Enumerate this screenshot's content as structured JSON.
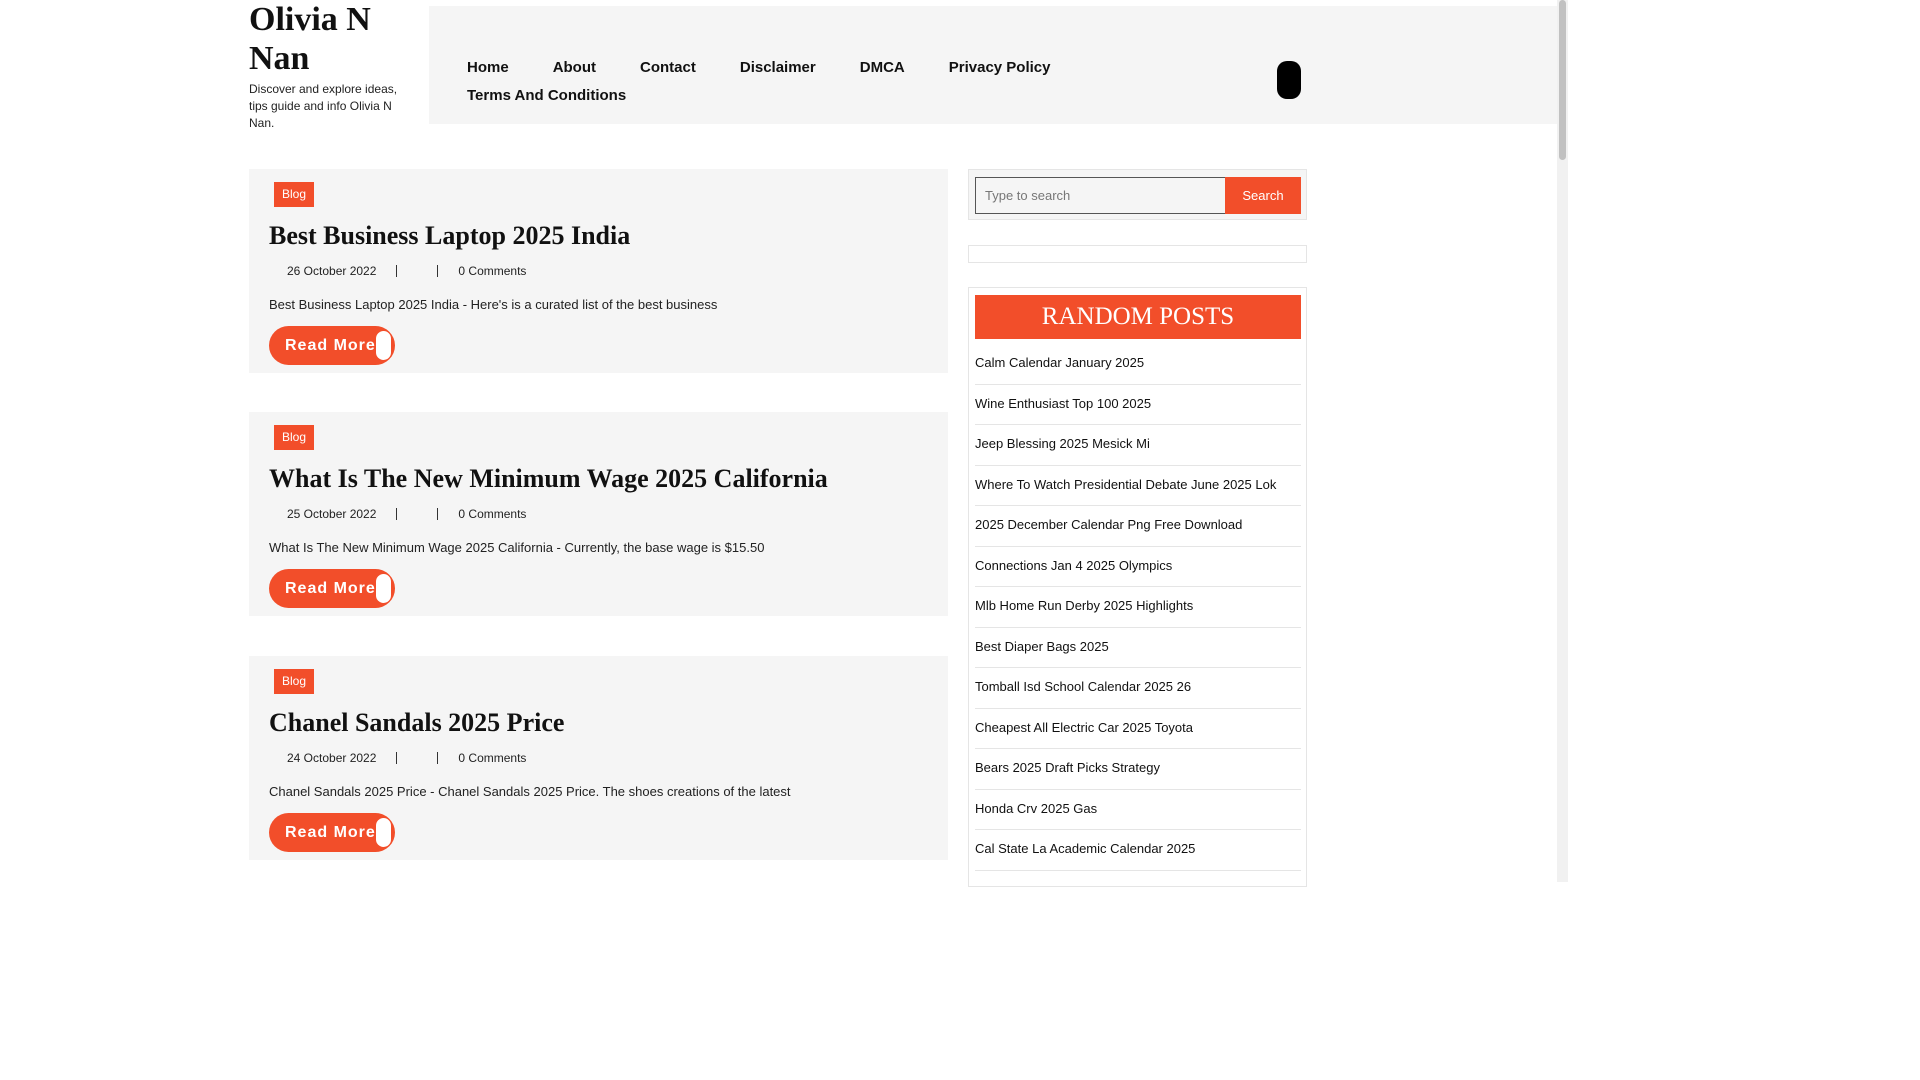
{
  "site": {
    "title": "Olivia N Nan",
    "tagline": "Discover and explore ideas, tips guide and info Olivia N Nan."
  },
  "nav": {
    "items": [
      {
        "label": "Home"
      },
      {
        "label": "About"
      },
      {
        "label": "Contact"
      },
      {
        "label": "Disclaimer"
      },
      {
        "label": "DMCA"
      },
      {
        "label": "Privacy Policy"
      },
      {
        "label": "Terms And Conditions"
      }
    ],
    "toggle_icon": "menu-toggle-icon"
  },
  "posts": [
    {
      "category": "Blog",
      "title": "Best Business Laptop 2025 India",
      "date": "26 October 2022",
      "comments": "0 Comments",
      "excerpt": "Best Business Laptop 2025 India - Here's is a curated list of the best business",
      "read_more": "Read More"
    },
    {
      "category": "Blog",
      "title": "What Is The New Minimum Wage 2025 California",
      "date": "25 October 2022",
      "comments": "0 Comments",
      "excerpt": "What Is The New Minimum Wage 2025 California - Currently, the base wage is $15.50",
      "read_more": "Read More"
    },
    {
      "category": "Blog",
      "title": "Chanel Sandals 2025 Price",
      "date": "24 October 2022",
      "comments": "0 Comments",
      "excerpt": "Chanel Sandals 2025 Price - Chanel Sandals 2025 Price. The shoes creations of the latest",
      "read_more": "Read More"
    }
  ],
  "sidebar": {
    "search": {
      "placeholder": "Type to search",
      "button": "Search"
    },
    "random_posts": {
      "heading": "RANDOM POSTS",
      "items": [
        "Calm Calendar January 2025",
        "Wine Enthusiast Top 100 2025",
        "Jeep Blessing 2025 Mesick Mi",
        "Where To Watch Presidential Debate June 2025 Lok",
        "2025 December Calendar Png Free Download",
        "Connections Jan 4 2025 Olympics",
        "Mlb Home Run Derby 2025 Highlights",
        "Best Diaper Bags 2025",
        "Tomball Isd School Calendar 2025 26",
        "Cheapest All Electric Car 2025 Toyota",
        "Bears 2025 Draft Picks Strategy",
        "Honda Crv 2025 Gas",
        "Cal State La Academic Calendar 2025"
      ]
    }
  },
  "colors": {
    "accent": "#f24e2a",
    "panel_bg": "#f5f5f5"
  }
}
